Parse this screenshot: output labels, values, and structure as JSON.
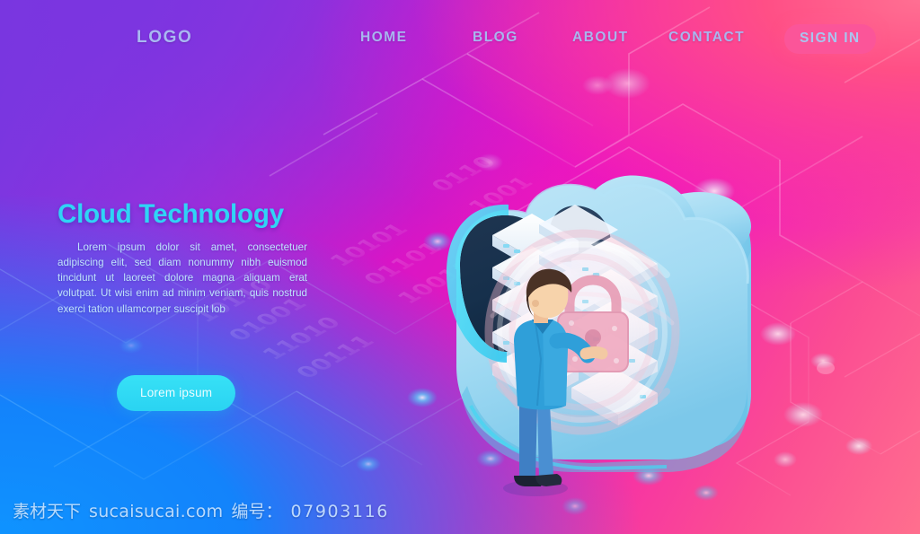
{
  "nav": {
    "logo": "LOGO",
    "items": [
      {
        "label": "HOME"
      },
      {
        "label": "BLOG"
      },
      {
        "label": "ABOUT"
      },
      {
        "label": "CONTACT"
      }
    ],
    "signin_label": "SIGN IN"
  },
  "hero": {
    "title": "Cloud Technology",
    "body": "Lorem ipsum dolor sit amet, consectetuer adipiscing elit, sed diam nonummy nibh euismod tincidunt ut laoreet dolore magna aliquam erat volutpat. Ut wisi enim ad minim veniam, quis nostrud exerci tation ullamcorper suscipit lob",
    "cta_label": "Lorem ipsum"
  },
  "illustration": {
    "name": "isometric-cloud-security",
    "elements": [
      "cloud-shell",
      "server-racks",
      "padlock-icon",
      "data-swirl",
      "person-figure",
      "binary-ground-plane",
      "circuit-nodes"
    ]
  },
  "watermark": {
    "site_cn": "素材天下",
    "domain": "sucaisucai.com",
    "id_label": "编号：",
    "id_value": "07903116"
  },
  "colors": {
    "accent_cyan": "#2fd4f6",
    "cta_cyan": "#2ad3f2",
    "nav_text": "#a8b6ee",
    "signin_pink": "#fb5599",
    "bg_purple": "#7b35e0",
    "bg_magenta": "#f013c8",
    "bg_coral": "#ff6f92",
    "bg_blue": "#0f93ff",
    "body_text": "#bfe2fb",
    "cloud_blue": "#8fd3f0",
    "padlock_pink": "#efa9bd",
    "suit_blue": "#2a9fd8"
  }
}
